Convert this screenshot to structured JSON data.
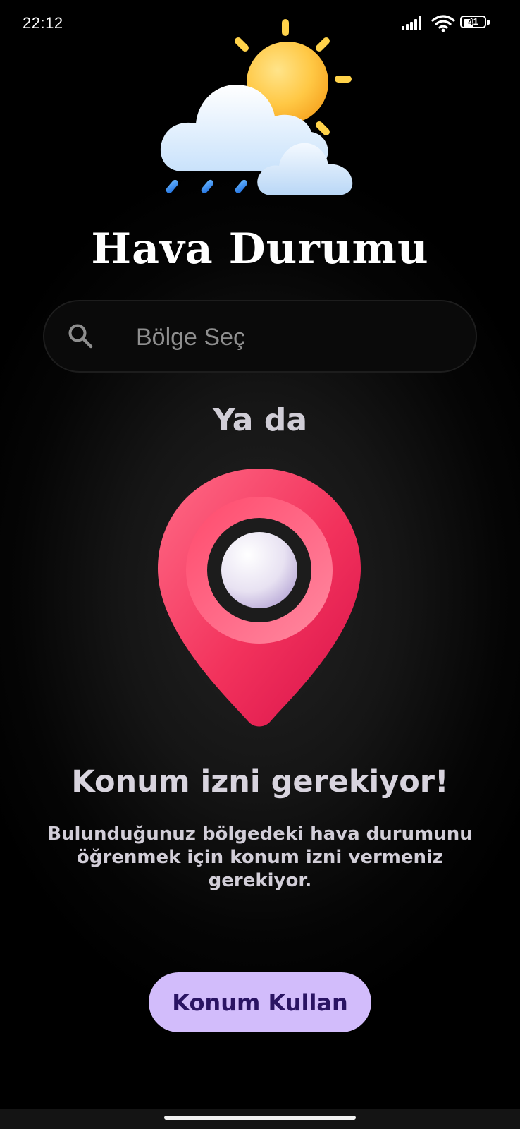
{
  "status_bar": {
    "time": "22:12",
    "battery_level": "41",
    "icons": [
      "signal-icon",
      "wifi-icon",
      "battery-icon"
    ]
  },
  "header": {
    "logo_icon": "weather-sun-cloud-rain-icon",
    "title": "Hava Durumu"
  },
  "search": {
    "icon": "search-icon",
    "placeholder": "Bölge Seç",
    "value": ""
  },
  "divider_text": "Ya da",
  "location": {
    "icon": "location-pin-icon",
    "title": "Konum izni gerekiyor!",
    "description": "Bulunduğunuz bölgedeki hava durumunu öğrenmek için konum izni vermeniz gerekiyor.",
    "button_label": "Konum Kullan"
  },
  "colors": {
    "background": "#000000",
    "accent_button": "#d2bcfb",
    "button_text": "#2a1463",
    "pin_red": "#f0305e",
    "text_light": "#d8d4de"
  }
}
